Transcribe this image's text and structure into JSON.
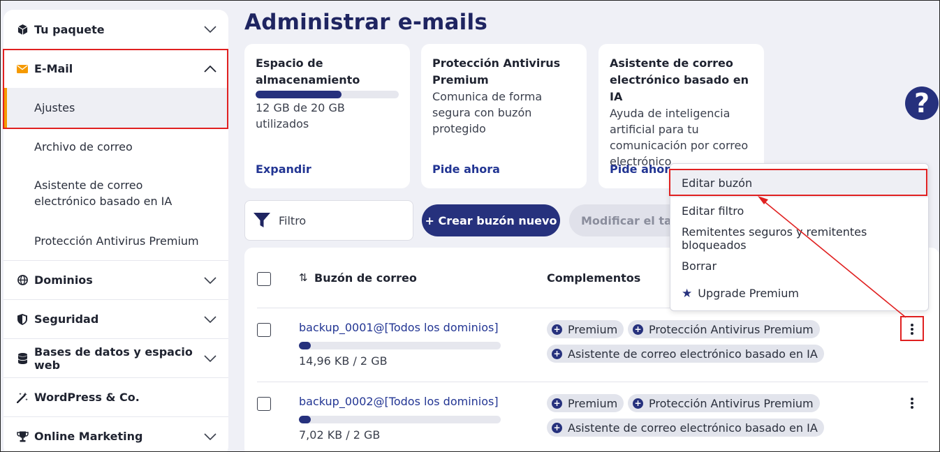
{
  "sidebar": {
    "items": [
      {
        "label": "Tu paquete",
        "icon": "box-icon"
      },
      {
        "label": "E-Mail",
        "icon": "envelope-icon"
      },
      {
        "label": "Dominios",
        "icon": "globe-icon"
      },
      {
        "label": "Seguridad",
        "icon": "shield-icon"
      },
      {
        "label": "Bases de datos y espacio web",
        "icon": "database-icon"
      },
      {
        "label": "WordPress & Co.",
        "icon": "magic-wand-icon"
      },
      {
        "label": "Online Marketing",
        "icon": "trophy-icon"
      }
    ],
    "email_subitems": [
      {
        "label": "Ajustes"
      },
      {
        "label": "Archivo de correo"
      },
      {
        "label": "Asistente de correo electrónico basado en IA"
      },
      {
        "label": "Protección Antivirus Premium"
      }
    ]
  },
  "page": {
    "title": "Administrar e-mails"
  },
  "cards": [
    {
      "title": "Espacio de almacenamiento",
      "usage_text": "12 GB de 20 GB utilizados",
      "usage_fraction": 0.6,
      "link": "Expandir"
    },
    {
      "title": "Protección Antivirus Premium",
      "description": "Comunica de forma segura con buzón protegido",
      "link": "Pide ahora"
    },
    {
      "title": "Asistente de correo electrónico basado en IA",
      "description": "Ayuda de inteligencia artificial para tu comunicación por correo electrónico",
      "link": "Pide ahora"
    }
  ],
  "toolbar": {
    "filter_placeholder": "Filtro",
    "create_label": "+ Crear buzón nuevo",
    "modify_label": "Modificar el tamaño"
  },
  "help": {
    "label": "?"
  },
  "table": {
    "headers": {
      "mailbox": "Buzón de correo",
      "addons": "Complementos",
      "sort_icon": "⇅"
    },
    "rows": [
      {
        "email": "backup_0001@[Todos los dominios]",
        "usage": "14,96 KB / 2 GB",
        "usage_fraction": 0.06,
        "addons": [
          "Premium",
          "Protección Antivirus Premium",
          "Asistente de correo electrónico basado en IA"
        ]
      },
      {
        "email": "backup_0002@[Todos los dominios]",
        "usage": "7,02 KB / 2 GB",
        "usage_fraction": 0.06,
        "addons": [
          "Premium",
          "Protección Antivirus Premium",
          "Asistente de correo electrónico basado en IA"
        ]
      }
    ]
  },
  "dropdown": {
    "items": [
      {
        "label": "Editar buzón"
      },
      {
        "label": "Editar filtro"
      },
      {
        "label": "Remitentes seguros y remitentes bloqueados"
      },
      {
        "label": "Borrar"
      },
      {
        "label": "Upgrade Premium"
      }
    ]
  },
  "colors": {
    "brand": "#26317d",
    "accent": "#f59a00",
    "highlight": "#e02020"
  }
}
